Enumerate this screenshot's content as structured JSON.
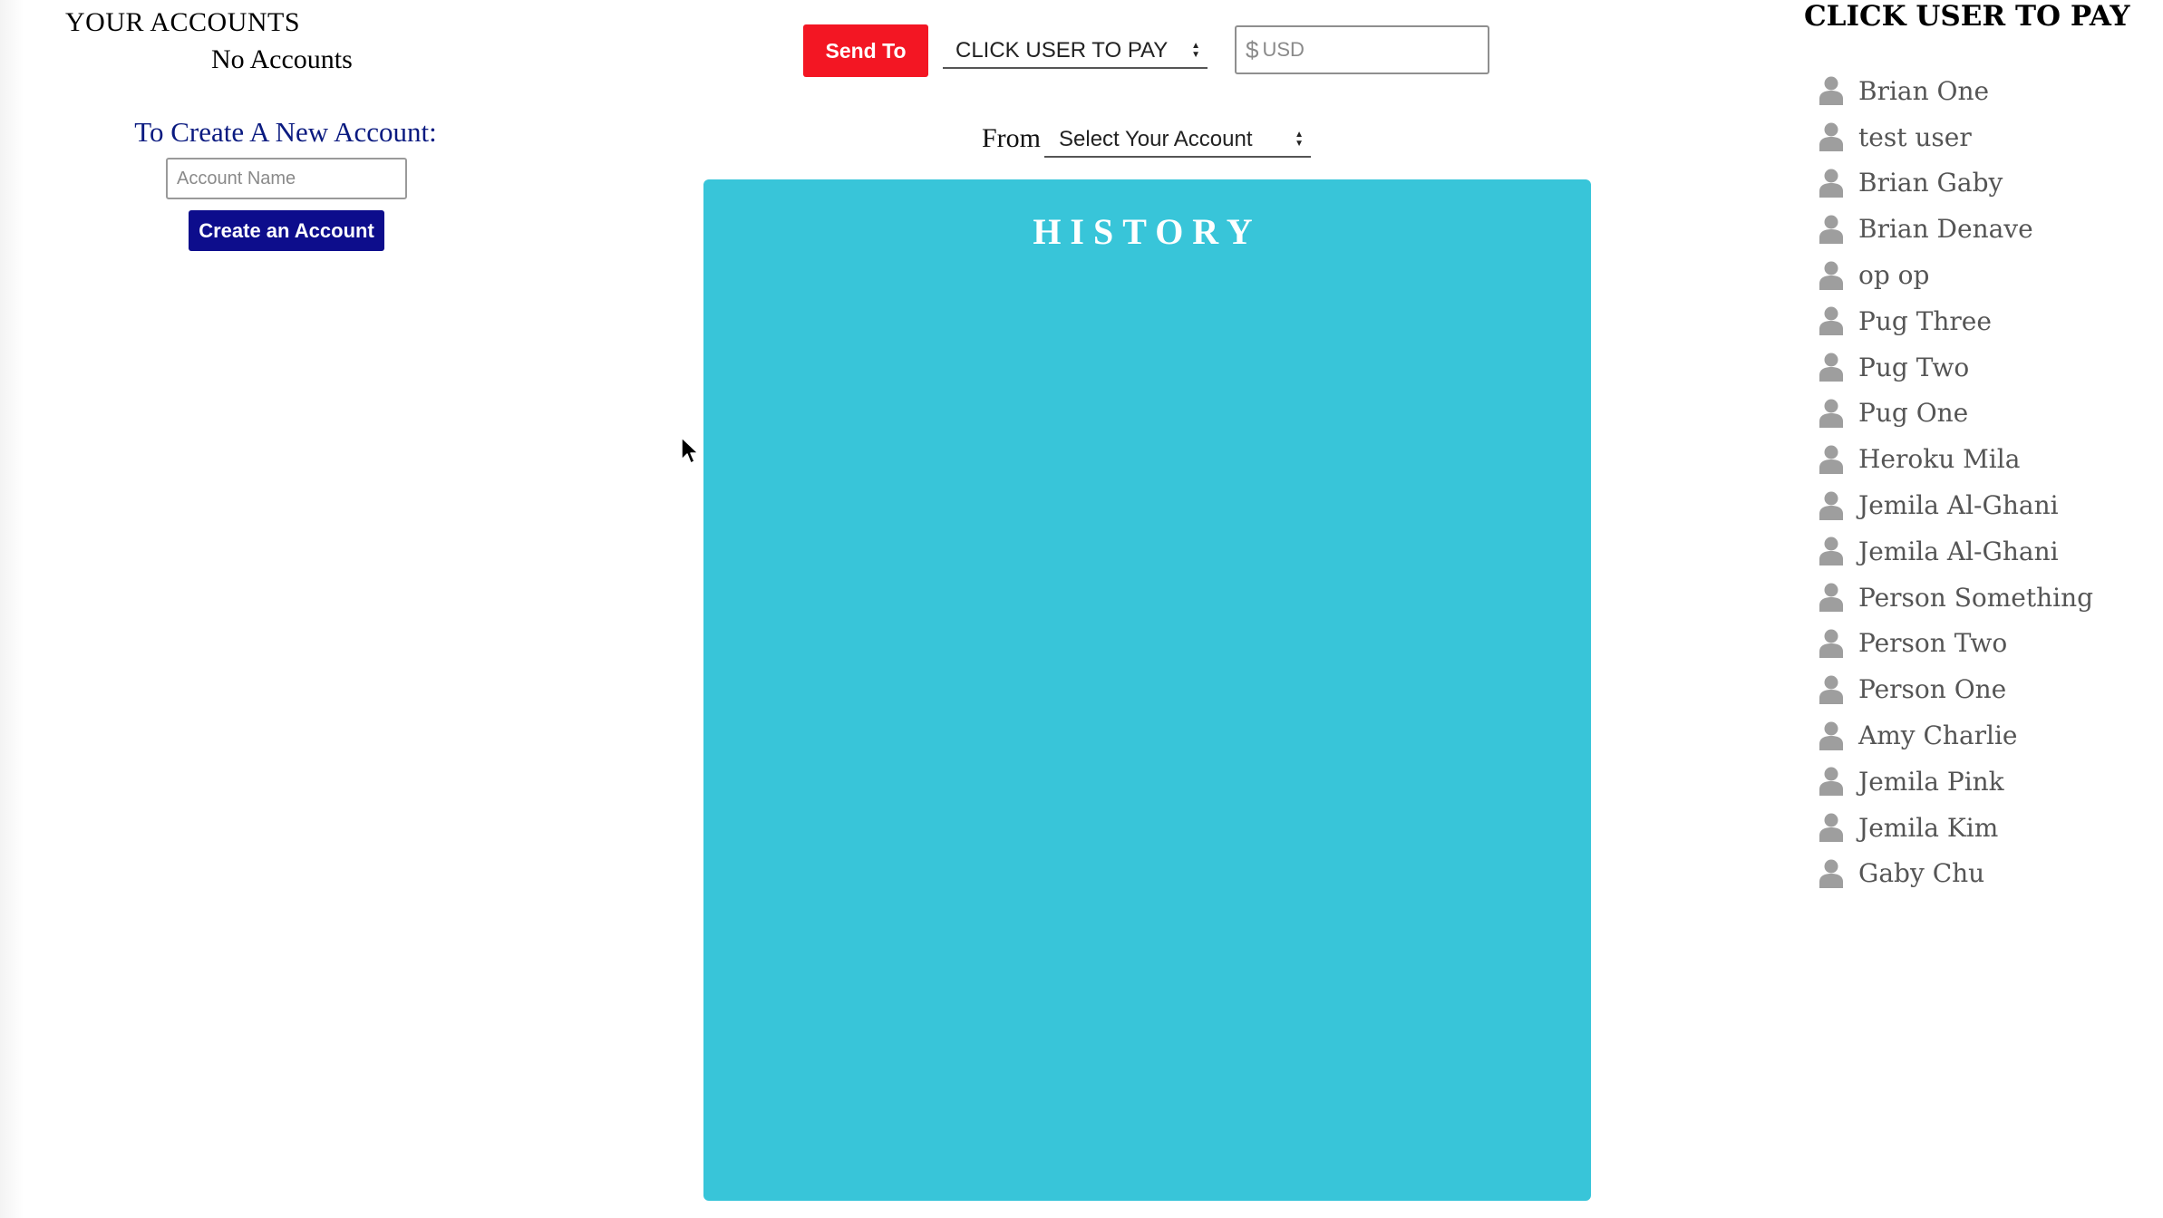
{
  "accounts": {
    "title": "YOUR ACCOUNTS",
    "empty_text": "No Accounts",
    "create_heading": "To Create A New Account:",
    "account_name_placeholder": "Account Name",
    "create_button_label": "Create an Account"
  },
  "payment": {
    "send_button_label": "Send To",
    "user_select_value": "CLICK USER TO PAY",
    "currency_symbol": "$",
    "amount_placeholder": "USD",
    "from_label": "From",
    "account_select_value": "Select Your Account"
  },
  "history": {
    "title": "HISTORY",
    "background_color": "#38c5d9"
  },
  "users": {
    "title": "CLICK USER TO PAY",
    "items": [
      {
        "name": "Brian One"
      },
      {
        "name": "test user"
      },
      {
        "name": "Brian Gaby"
      },
      {
        "name": "Brian Denave"
      },
      {
        "name": "op op"
      },
      {
        "name": "Pug Three"
      },
      {
        "name": "Pug Two"
      },
      {
        "name": "Pug One"
      },
      {
        "name": "Heroku Mila"
      },
      {
        "name": "Jemila Al-Ghani"
      },
      {
        "name": "Jemila Al-Ghani"
      },
      {
        "name": "Person Something"
      },
      {
        "name": "Person Two"
      },
      {
        "name": "Person One"
      },
      {
        "name": "Amy Charlie"
      },
      {
        "name": "Jemila Pink"
      },
      {
        "name": "Jemila Kim"
      },
      {
        "name": "Gaby Chu"
      }
    ]
  },
  "colors": {
    "send_button": "#f31623",
    "create_button": "#0d0d8c",
    "create_heading": "#0a1a80",
    "user_icon": "#9e9e9e"
  },
  "icons": {
    "user": "user-icon",
    "cursor": "cursor-arrow-icon",
    "select_arrows": "up-down-arrows-icon"
  }
}
